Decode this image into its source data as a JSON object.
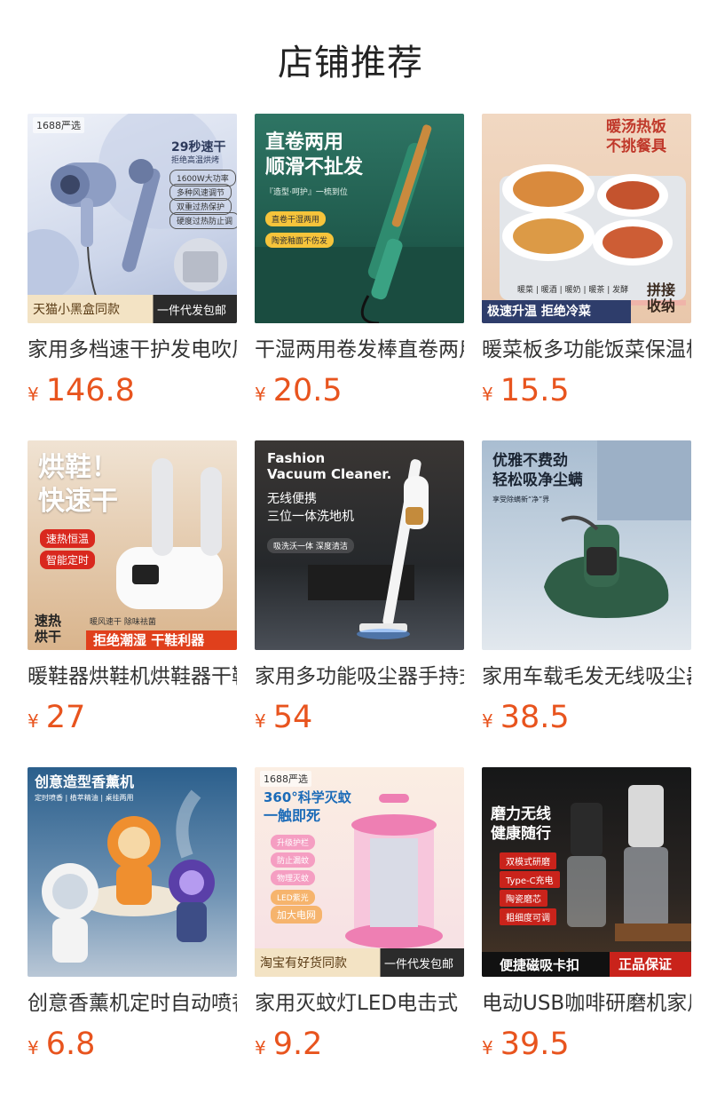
{
  "page": {
    "title": "店铺推荐"
  },
  "currency": "¥",
  "accent": "#e8541e",
  "products": [
    {
      "name": "家用多档速干护发电吹风",
      "price": "146.8",
      "image": {
        "badge": "1688严选",
        "headline": "29秒速干",
        "sub": "拒绝高温烘烤",
        "chips": [
          "1600W大功率",
          "多种风速调节",
          "双重过热保护",
          "硬度过热防止调"
        ],
        "bar_left": "天猫小黑盒同款",
        "bar_right": "一件代发包邮"
      }
    },
    {
      "name": "干湿两用卷发棒直卷两用",
      "price": "20.5",
      "image": {
        "headline": "直卷两用",
        "headline2": "顺滑不扯发",
        "sub": "『造型·呵护』一梳到位",
        "chips": [
          "直卷干湿两用",
          "陶瓷釉面不伤发"
        ]
      }
    },
    {
      "name": "暖菜板多功能饭菜保温板",
      "price": "15.5",
      "image": {
        "headline": "暖汤热饭",
        "headline2": "不挑餐具",
        "chips": [
          "暖菜",
          "暖酒",
          "暖奶",
          "暖茶",
          "发酵"
        ],
        "bar_left": "极速升温 拒绝冷菜",
        "bar_right": "拼接收纳"
      }
    },
    {
      "name": "暖鞋器烘鞋机烘鞋器干鞋器",
      "price": "27",
      "image": {
        "headline": "烘鞋！",
        "headline2": "快速干",
        "chips": [
          "速热恒温",
          "智能定时"
        ],
        "bar_left": "速热烘干",
        "bar_mid": "暖风速干 除味祛菌",
        "bar_right": "拒绝潮湿 干鞋利器"
      }
    },
    {
      "name": "家用多功能吸尘器手持式",
      "price": "54",
      "image": {
        "headline": "Fashion",
        "headline2": "Vacuum Cleaner.",
        "sub": "无线便携",
        "sub2": "三位一体洗地机",
        "chips": [
          "吸洗沃一体 深度清洁"
        ]
      }
    },
    {
      "name": "家用车载毛发无线吸尘器",
      "price": "38.5",
      "image": {
        "headline": "优雅不费劲",
        "headline2": "轻松吸净尘螨",
        "sub": "享受除螨新“净”界"
      }
    },
    {
      "name": "创意香薰机定时自动喷香",
      "price": "6.8",
      "image": {
        "headline": "创意造型香薰机",
        "chips": [
          "定时喷香",
          "植萃精油",
          "桌挂两用"
        ]
      }
    },
    {
      "name": "家用灭蚊灯LED电击式",
      "price": "9.2",
      "image": {
        "badge": "1688严选",
        "headline": "360°科学灭蚊",
        "headline2": "一触即死",
        "chips": [
          "升级护栏",
          "防止漏蚊",
          "物理灭蚊",
          "LED紫光",
          "加大电网"
        ],
        "bar_left": "淘宝有好货同款",
        "bar_right": "一件代发包邮"
      }
    },
    {
      "name": "电动USB咖啡研磨机家用",
      "price": "39.5",
      "image": {
        "headline": "磨力无线",
        "headline2": "健康随行",
        "chips": [
          "双模式研磨",
          "Type-C充电",
          "陶瓷磨芯",
          "粗细度可调"
        ],
        "bar_left": "便捷磁吸卡扣",
        "bar_right": "正品保证"
      }
    }
  ]
}
